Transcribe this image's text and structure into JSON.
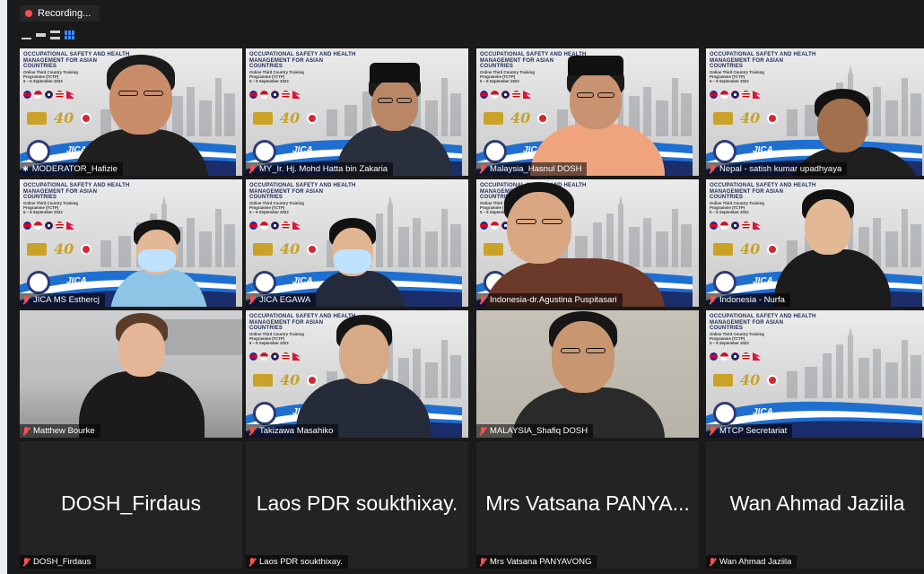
{
  "recording": {
    "label": "Recording..."
  },
  "banner": {
    "title": "OCCUPATIONAL SAFETY AND HEALTH MANAGEMENT FOR ASIAN COUNTRIES",
    "subtitle_1": "Online Third Country Training",
    "subtitle_2": "Programme (TCTP)",
    "dates": "5 – 9 September 2022",
    "anniversary": "40",
    "jica": "JICA"
  },
  "colors": {
    "muted_mic": "#ff4d4d",
    "active_speaker": "#5ed35e",
    "grid_view_icon": "#3d8bff"
  },
  "participants": [
    {
      "name": "MODERATOR_Hafizie",
      "muted": false,
      "video": true,
      "active": true
    },
    {
      "name": "MY_Ir. Hj. Mohd Hatta bin Zakaria",
      "muted": true,
      "video": true
    },
    {
      "name": "Malaysia_Hasnul DOSH",
      "muted": true,
      "video": true
    },
    {
      "name": "Nepal - satish kumar upadhyaya",
      "muted": true,
      "video": true
    },
    {
      "name": "JICA MS Esthercj",
      "muted": true,
      "video": true
    },
    {
      "name": "JICA EGAWA",
      "muted": true,
      "video": true
    },
    {
      "name": "Indonesia-dr.Agustina Puspitasari",
      "muted": true,
      "video": true
    },
    {
      "name": "Indonesia - Nurfa",
      "muted": true,
      "video": true
    },
    {
      "name": "Matthew Bourke",
      "muted": true,
      "video": true
    },
    {
      "name": "Takizawa Masahiko",
      "muted": true,
      "video": true
    },
    {
      "name": "MALAYSIA_Shafiq DOSH",
      "muted": true,
      "video": true
    },
    {
      "name": "MTCP Secretariat",
      "muted": true,
      "video": true
    },
    {
      "name": "DOSH_Firdaus",
      "display": "DOSH_Firdaus",
      "muted": true,
      "video": false
    },
    {
      "name": "Laos PDR soukthixay.",
      "display": "Laos PDR soukthixay.",
      "muted": true,
      "video": false
    },
    {
      "name": "Mrs Vatsana PANYAVONG",
      "display": "Mrs Vatsana PANYA...",
      "muted": true,
      "video": false
    },
    {
      "name": "Wan Ahmad Jaziila",
      "display": "Wan Ahmad Jaziila",
      "muted": true,
      "video": false
    }
  ]
}
